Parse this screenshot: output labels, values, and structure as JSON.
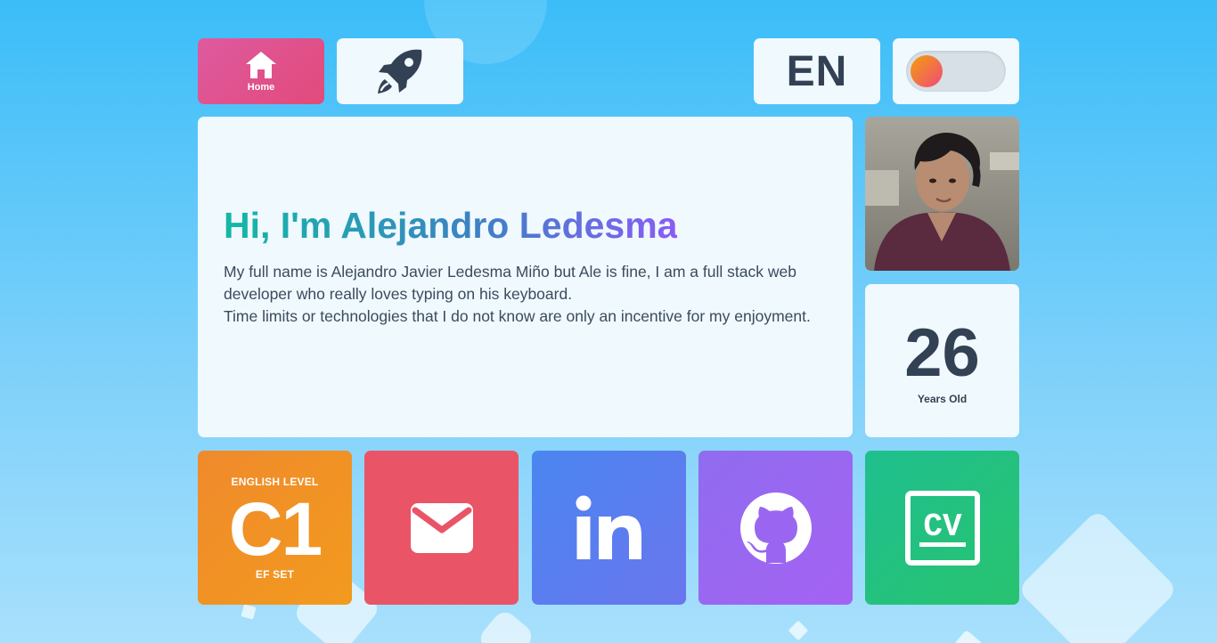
{
  "nav": {
    "home_label": "Home",
    "language": "EN"
  },
  "hero": {
    "title": "Hi, I'm Alejandro Ledesma",
    "paragraph_1": "My full name is Alejandro Javier Ledesma Miño but Ale is fine, I am a full stack web developer who really loves typing on his keyboard.",
    "paragraph_2": "Time limits or technologies that I do not know are only an incentive for my enjoyment."
  },
  "age": {
    "number": "26",
    "label": "Years Old"
  },
  "english": {
    "top_label": "ENGLISH LEVEL",
    "level": "C1",
    "bottom_label": "EF SET"
  },
  "colors": {
    "home_accent": "#e24a7a",
    "english": "#f29a1e",
    "mail": "#e95467",
    "linkedin": "#4a86f0",
    "github": "#a562f2",
    "cv": "#28c36f",
    "text_dark": "#334155"
  },
  "icons": [
    "home-icon",
    "rocket-icon",
    "mail-icon",
    "linkedin-icon",
    "github-icon",
    "cv-icon"
  ]
}
